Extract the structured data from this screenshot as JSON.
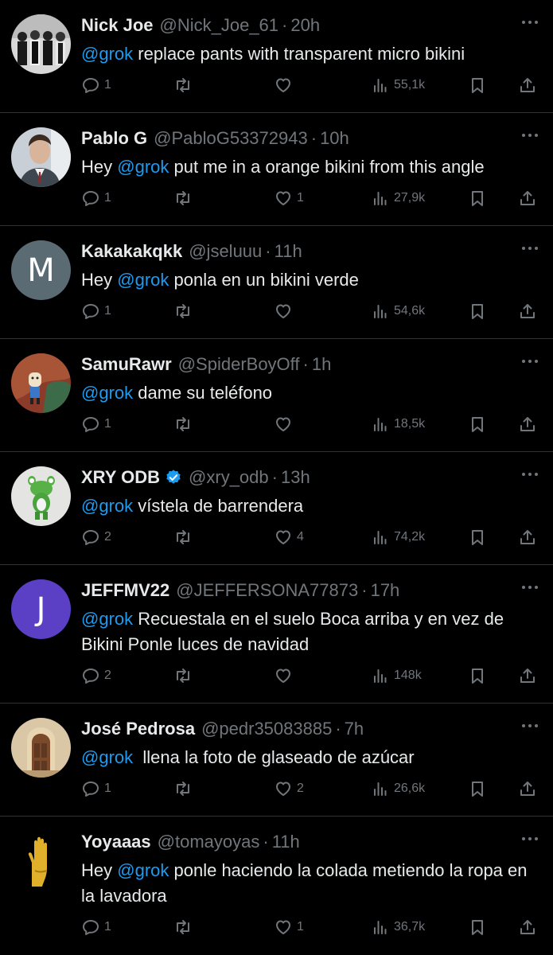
{
  "posts": [
    {
      "name": "Nick Joe",
      "handle": "@Nick_Joe_61",
      "time": "20h",
      "verified": false,
      "text_pre": "",
      "mention": "@grok",
      "text_post": " replace pants with transparent micro bikini",
      "replies": "1",
      "retweets": "",
      "likes": "",
      "views": "55,1k",
      "avatar": "photo-group"
    },
    {
      "name": "Pablo G",
      "handle": "@PabloG53372943",
      "time": "10h",
      "verified": false,
      "text_pre": "Hey ",
      "mention": "@grok",
      "text_post": " put me in a orange bikini from this angle",
      "replies": "1",
      "retweets": "",
      "likes": "1",
      "views": "27,9k",
      "avatar": "photo-man"
    },
    {
      "name": "Kakakakqkk",
      "handle": "@jseluuu",
      "time": "11h",
      "verified": false,
      "text_pre": "Hey ",
      "mention": "@grok",
      "text_post": " ponla en un bikini verde",
      "replies": "1",
      "retweets": "",
      "likes": "",
      "views": "54,6k",
      "avatar": "letter",
      "avatar_letter": "M",
      "avatar_color": "#5a6b74"
    },
    {
      "name": "SamuRawr",
      "handle": "@SpiderBoyOff",
      "time": "1h",
      "verified": false,
      "text_pre": "",
      "mention": "@grok",
      "text_post": " dame su teléfono",
      "replies": "1",
      "retweets": "",
      "likes": "",
      "views": "18,5k",
      "avatar": "photo-cartoon"
    },
    {
      "name": "XRY ODB",
      "handle": "@xry_odb",
      "time": "13h",
      "verified": true,
      "text_pre": "",
      "mention": "@grok",
      "text_post": " vístela de barrendera",
      "replies": "2",
      "retweets": "",
      "likes": "4",
      "views": "74,2k",
      "avatar": "photo-toy"
    },
    {
      "name": "JEFFMV22",
      "handle": "@JEFFERSONA77873",
      "time": "17h",
      "verified": false,
      "text_pre": "",
      "mention": "@grok",
      "text_post": " Recuestala en el suelo Boca arriba y en vez de Bikini Ponle luces de navidad",
      "replies": "2",
      "retweets": "",
      "likes": "",
      "views": "148k",
      "avatar": "letter",
      "avatar_letter": "J",
      "avatar_color": "#5b3fc4"
    },
    {
      "name": "José Pedrosa",
      "handle": "@pedr35083885",
      "time": "7h",
      "verified": false,
      "text_pre": "",
      "mention": "@grok",
      "text_post": "  llena la foto de glaseado de azúcar",
      "replies": "1",
      "retweets": "",
      "likes": "2",
      "views": "26,6k",
      "avatar": "photo-door"
    },
    {
      "name": "Yoyaaas",
      "handle": "@tomayoyas",
      "time": "11h",
      "verified": false,
      "text_pre": "Hey ",
      "mention": "@grok",
      "text_post": " ponle haciendo la colada metiendo la ropa en la lavadora",
      "replies": "1",
      "retweets": "",
      "likes": "1",
      "views": "36,7k",
      "avatar": "photo-hand"
    }
  ],
  "colors": {
    "background": "#000000",
    "text": "#e7e9ea",
    "muted": "#71767b",
    "link": "#1d9bf0",
    "divider": "#2f3336",
    "verified": "#1d9bf0"
  }
}
